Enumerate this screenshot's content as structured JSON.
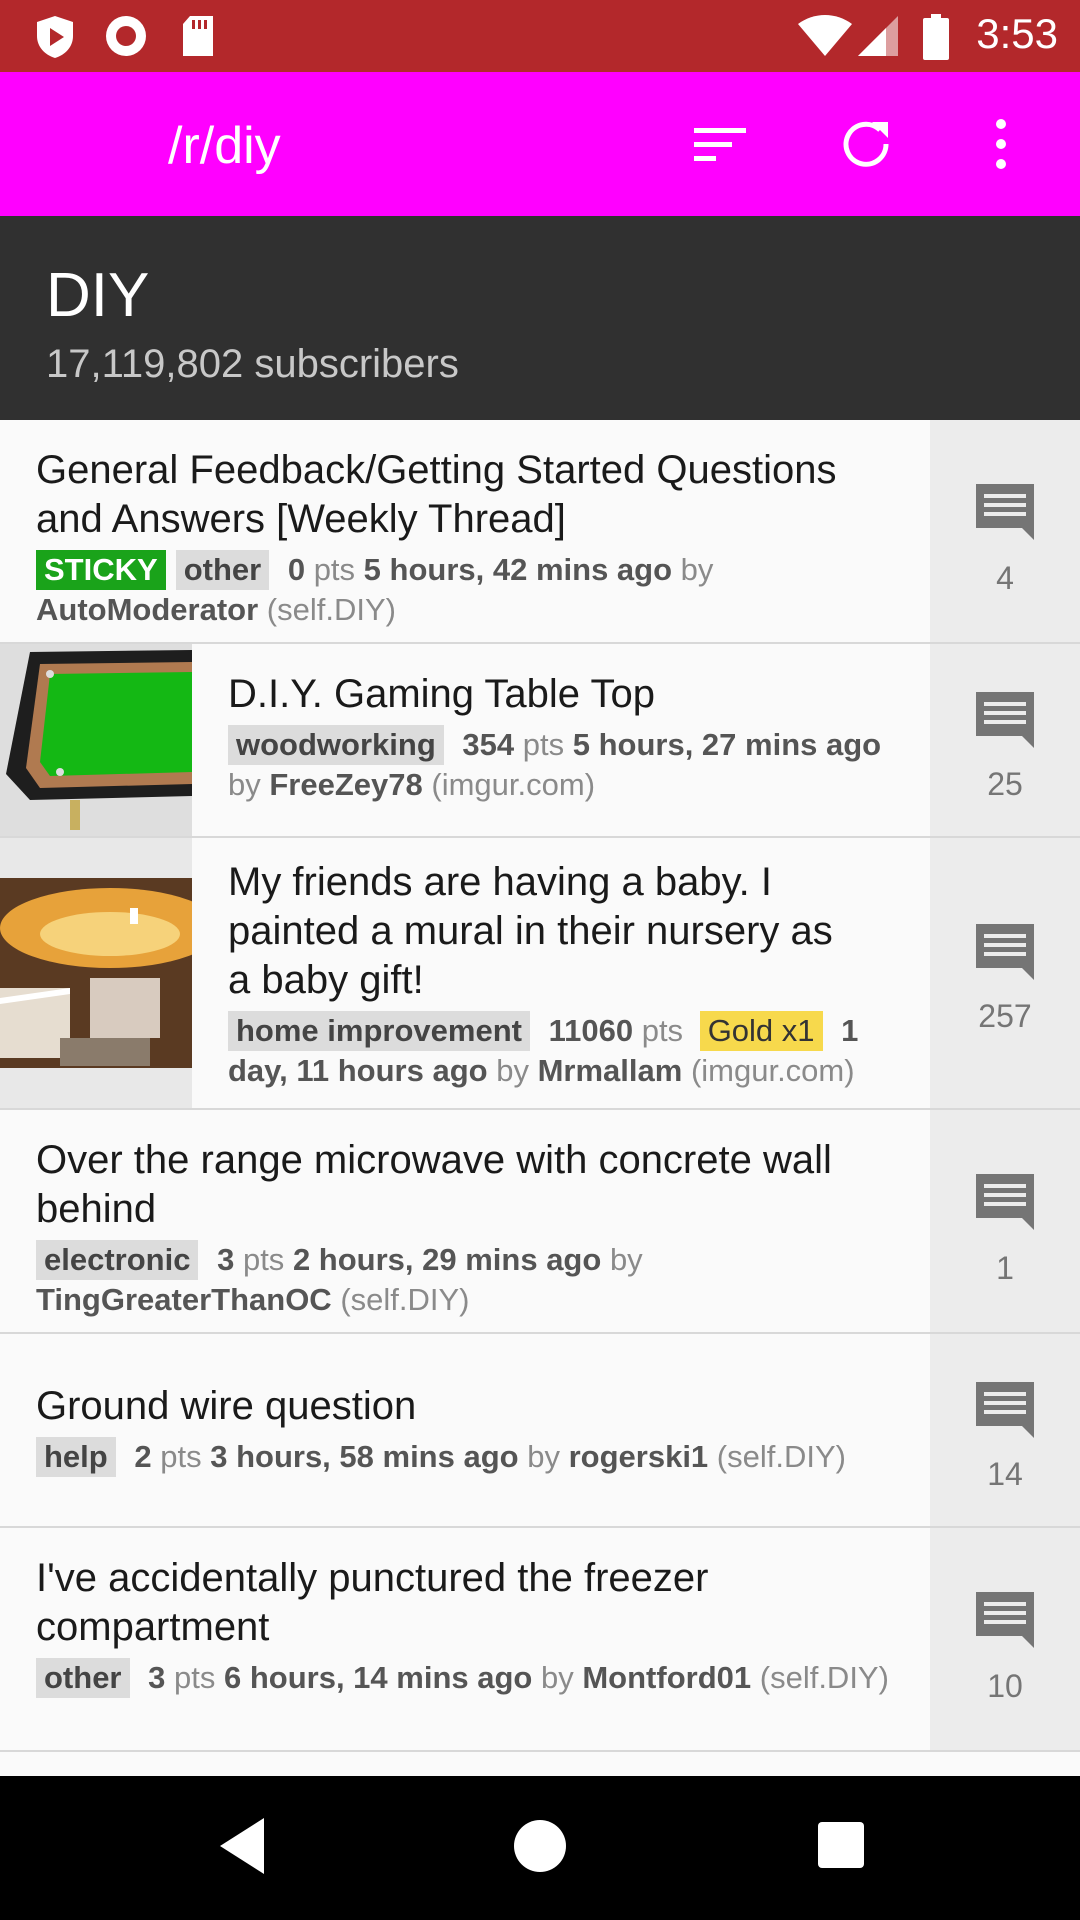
{
  "status_bar": {
    "time": "3:53",
    "icons": [
      "shield-play-icon",
      "record-icon",
      "sd-card-icon",
      "wifi-icon",
      "signal-icon",
      "battery-icon"
    ]
  },
  "app_bar": {
    "title": "/r/diy",
    "icons": [
      "sort-icon",
      "refresh-icon",
      "overflow-menu-icon"
    ],
    "background": "#ff00ff"
  },
  "subreddit": {
    "name": "DIY",
    "subscribers": "17,119,802 subscribers"
  },
  "posts": [
    {
      "title": "General Feedback/Getting Started Questions and Answers [Weekly Thread]",
      "flairs": [
        "STICKY",
        "other"
      ],
      "points": "0",
      "pts_label": "pts",
      "time": "5 hours, 42 mins ago",
      "by": "by",
      "author": "AutoModerator",
      "domain": "(self.DIY)",
      "comments": "4"
    },
    {
      "title": "D.I.Y. Gaming Table Top",
      "flairs": [
        "woodworking"
      ],
      "points": "354",
      "pts_label": "pts",
      "time": "5 hours, 27 mins ago",
      "by": "by",
      "author": "FreeZey78",
      "domain": "(imgur.com)",
      "comments": "25",
      "thumbnail": "gaming-table-thumbnail"
    },
    {
      "title": "My friends are having a baby. I painted a mural in their nursery as a baby gift!",
      "flairs": [
        "home improvement"
      ],
      "points": "11060",
      "pts_label": "pts",
      "gold": "Gold x1",
      "time": "1 day, 11 hours ago",
      "by": "by",
      "author": "Mrmallam",
      "domain": "(imgur.com)",
      "comments": "257",
      "thumbnail": "nursery-mural-thumbnail"
    },
    {
      "title": "Over the range microwave with concrete wall behind",
      "flairs": [
        "electronic"
      ],
      "points": "3",
      "pts_label": "pts",
      "time": "2 hours, 29 mins ago",
      "by": "by",
      "author": "TingGreaterThanOC",
      "domain": "(self.DIY)",
      "comments": "1"
    },
    {
      "title": "Ground wire question",
      "flairs": [
        "help"
      ],
      "points": "2",
      "pts_label": "pts",
      "time": "3 hours, 58 mins ago",
      "by": "by",
      "author": "rogerski1",
      "domain": "(self.DIY)",
      "comments": "14"
    },
    {
      "title": "I've accidentally punctured the freezer compartment",
      "flairs": [
        "other"
      ],
      "points": "3",
      "pts_label": "pts",
      "time": "6 hours, 14 mins ago",
      "by": "by",
      "author": "Montford01",
      "domain": "(self.DIY)",
      "comments": "10"
    }
  ],
  "nav_bar": {
    "icons": [
      "back-icon",
      "home-icon",
      "recents-icon"
    ]
  }
}
